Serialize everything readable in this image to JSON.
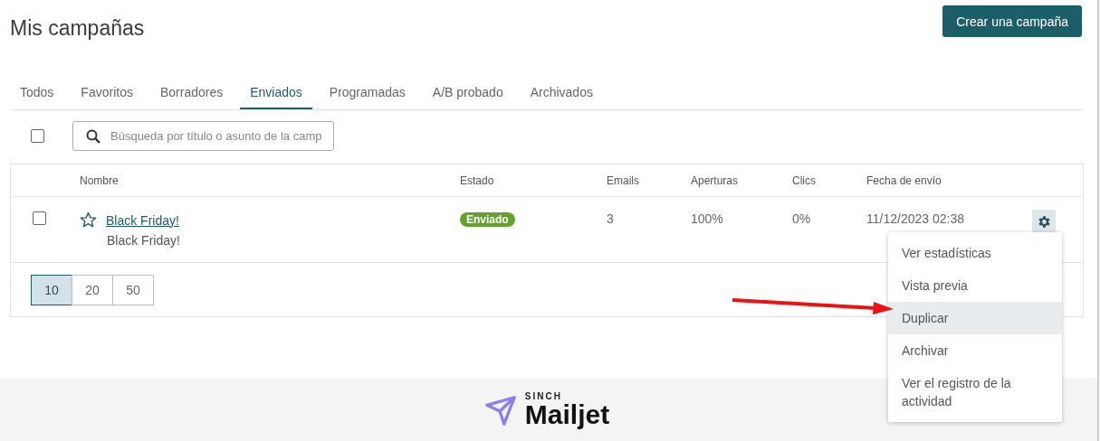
{
  "header": {
    "title": "Mis campañas",
    "create_button": "Crear una campaña"
  },
  "tabs": [
    {
      "label": "Todos",
      "selected": false
    },
    {
      "label": "Favoritos",
      "selected": false
    },
    {
      "label": "Borradores",
      "selected": false
    },
    {
      "label": "Enviados",
      "selected": true
    },
    {
      "label": "Programadas",
      "selected": false
    },
    {
      "label": "A/B probado",
      "selected": false
    },
    {
      "label": "Archivados",
      "selected": false
    }
  ],
  "toolbar": {
    "select_all_checked": false,
    "search": {
      "placeholder": "Búsqueda por título o asunto de la camp"
    }
  },
  "table": {
    "columns": [
      "Nombre",
      "Estado",
      "Emails",
      "Aperturas",
      "Clics",
      "Fecha de envío"
    ],
    "rows": [
      {
        "checked": false,
        "favorite": false,
        "name": "Black Friday!",
        "subject": "Black Friday!",
        "status": "Enviado",
        "emails": "3",
        "opens": "100%",
        "clicks": "0%",
        "sent_date": "11/12/2023 02:38"
      }
    ]
  },
  "page_sizes": [
    {
      "label": "10",
      "selected": true
    },
    {
      "label": "20",
      "selected": false
    },
    {
      "label": "50",
      "selected": false
    }
  ],
  "action_menu": {
    "items": [
      {
        "label": "Ver estadísticas",
        "selected": false
      },
      {
        "label": "Vista previa",
        "selected": false
      },
      {
        "label": "Duplicar",
        "selected": true
      },
      {
        "label": "Archivar",
        "selected": false
      },
      {
        "label": "Ver el registro de la actividad",
        "selected": false
      }
    ]
  },
  "footer": {
    "brand_small": "SINCH",
    "brand": "Mailjet"
  }
}
